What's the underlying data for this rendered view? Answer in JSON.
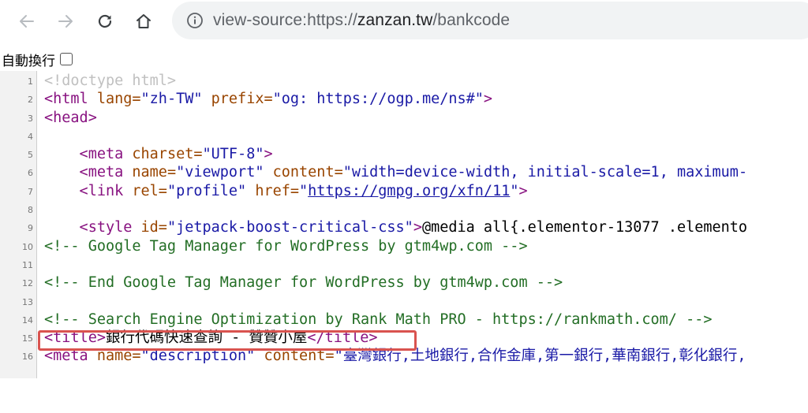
{
  "browser": {
    "url_prefix": "view-source:https://",
    "url_host": "zanzan.tw",
    "url_path": "/bankcode"
  },
  "wrap_toggle": {
    "label": "自動換行",
    "checked": false
  },
  "source_lines": [
    {
      "num": "1"
    },
    {
      "num": "2"
    },
    {
      "num": "3"
    },
    {
      "num": "4"
    },
    {
      "num": "5"
    },
    {
      "num": "6"
    },
    {
      "num": "7"
    },
    {
      "num": "8"
    },
    {
      "num": "9"
    },
    {
      "num": "10"
    },
    {
      "num": "11"
    },
    {
      "num": "12"
    },
    {
      "num": "13"
    },
    {
      "num": "14"
    },
    {
      "num": "15"
    },
    {
      "num": "16"
    }
  ],
  "code": {
    "l1": "<!doctype html>",
    "l2_tag_open": "<html ",
    "l2_attr1": "lang=",
    "l2_val1": "\"zh-TW\"",
    "l2_attr2": " prefix=",
    "l2_val2": "\"og: https://ogp.me/ns#\"",
    "l2_tag_close": ">",
    "l3": "<head>",
    "l5_tag": "    <meta ",
    "l5_attr": "charset=",
    "l5_val": "\"UTF-8\"",
    "l5_close": ">",
    "l6_tag": "    <meta ",
    "l6_attr1": "name=",
    "l6_val1": "\"viewport\"",
    "l6_attr2": " content=",
    "l6_val2": "\"width=device-width, initial-scale=1, maximum-",
    "l7_tag": "    <link ",
    "l7_attr1": "rel=",
    "l7_val1": "\"profile\"",
    "l7_attr2": " href=",
    "l7_q1": "\"",
    "l7_link": "https://gmpg.org/xfn/11",
    "l7_q2": "\"",
    "l7_close": ">",
    "l9_tag": "    <style ",
    "l9_attr": "id=",
    "l9_val": "\"jetpack-boost-critical-css\"",
    "l9_close": ">",
    "l9_text": "@media all{.elementor-13077 .elemento",
    "l10": "<!-- Google Tag Manager for WordPress by gtm4wp.com -->",
    "l12": "<!-- End Google Tag Manager for WordPress by gtm4wp.com -->",
    "l14": "<!-- Search Engine Optimization by Rank Math PRO - https://rankmath.com/ -->",
    "l15_open": "<title>",
    "l15_text": "銀行代碼快速查詢 - 贊贊小屋",
    "l15_close": "</title>",
    "l16_tag": "<meta ",
    "l16_attr1": "name=",
    "l16_val1": "\"description\"",
    "l16_attr2": " content=",
    "l16_val2": "\"臺灣銀行,土地銀行,合作金庫,第一銀行,華南銀行,彰化銀行,"
  },
  "colors": {
    "tag": "#881280",
    "attribute": "#994500",
    "value": "#1a1aa6",
    "comment": "#236e25",
    "highlight_border": "#d9534f"
  }
}
